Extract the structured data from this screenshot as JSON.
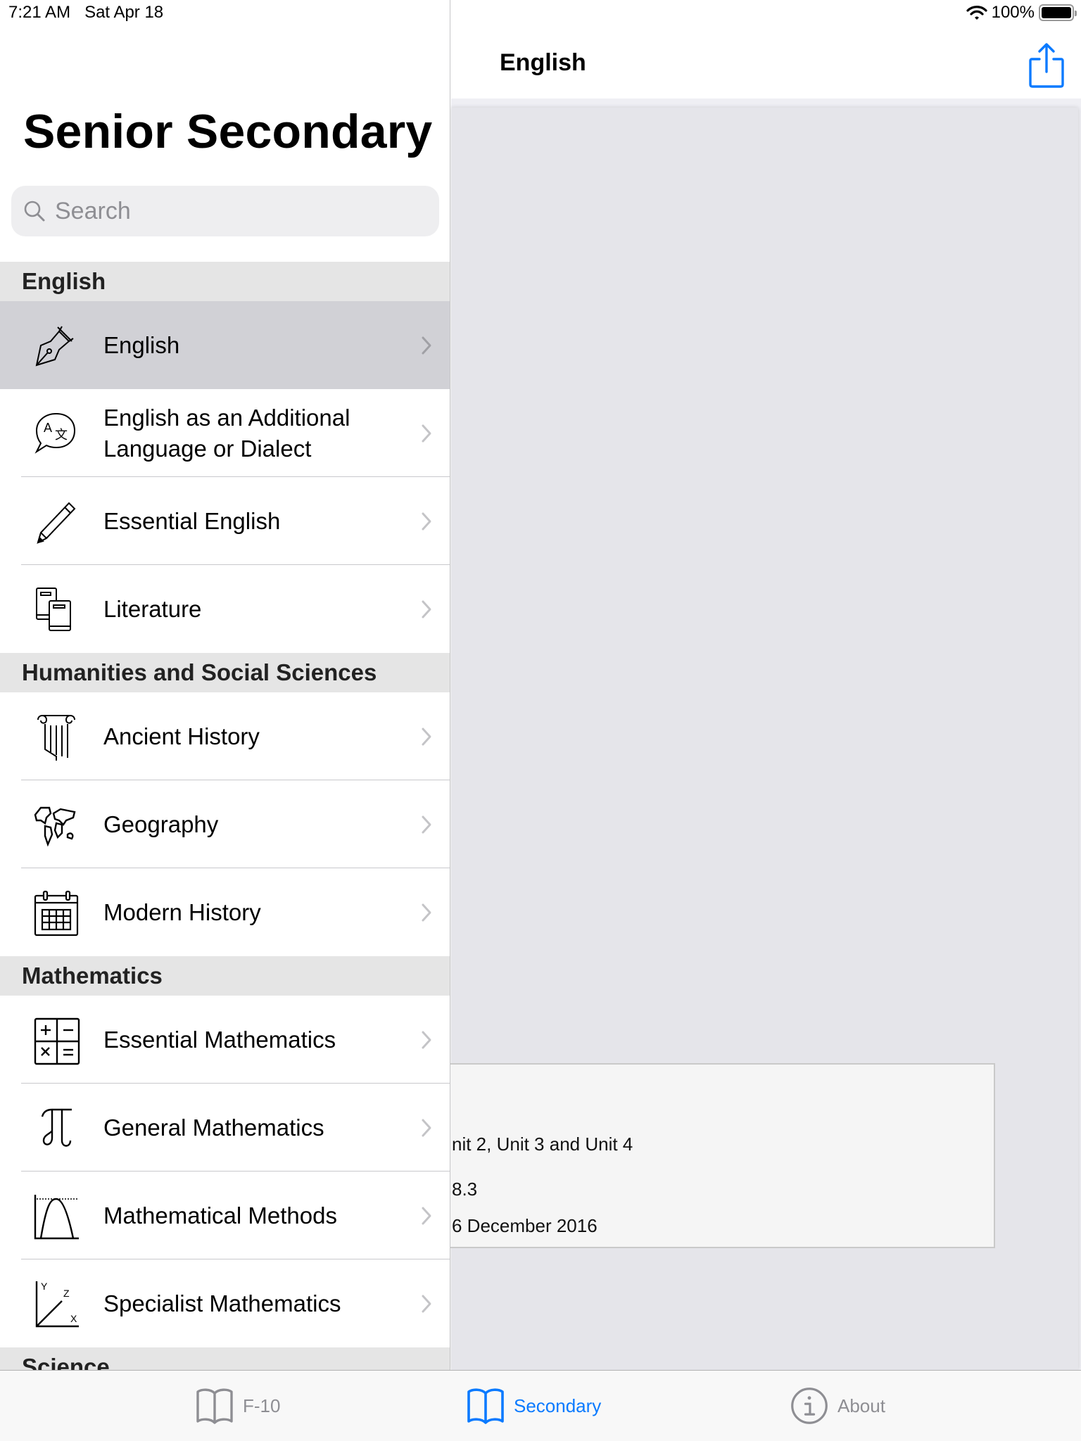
{
  "status_bar": {
    "time": "7:21 AM",
    "date": "Sat Apr 18",
    "battery_percent": "100%",
    "battery_level": 1.0
  },
  "sidebar": {
    "title": "Senior Secondary",
    "search": {
      "placeholder": "Search",
      "value": ""
    },
    "sections": [
      {
        "header": "English",
        "items": [
          {
            "label": "English",
            "icon": "fountain-pen-icon",
            "selected": true
          },
          {
            "label": "English as an Additional Language or Dialect",
            "icon": "translate-bubble-icon",
            "selected": false
          },
          {
            "label": "Essential English",
            "icon": "pencil-icon",
            "selected": false
          },
          {
            "label": "Literature",
            "icon": "books-icon",
            "selected": false
          }
        ]
      },
      {
        "header": "Humanities and Social Sciences",
        "items": [
          {
            "label": "Ancient History",
            "icon": "ionic-column-icon",
            "selected": false
          },
          {
            "label": "Geography",
            "icon": "world-map-icon",
            "selected": false
          },
          {
            "label": "Modern History",
            "icon": "calendar-icon",
            "selected": false
          }
        ]
      },
      {
        "header": "Mathematics",
        "items": [
          {
            "label": "Essential Mathematics",
            "icon": "calculator-operators-icon",
            "selected": false
          },
          {
            "label": "General Mathematics",
            "icon": "pi-icon",
            "selected": false
          },
          {
            "label": "Mathematical Methods",
            "icon": "parabola-graph-icon",
            "selected": false
          },
          {
            "label": "Specialist Mathematics",
            "icon": "xyz-axes-icon",
            "selected": false
          }
        ]
      },
      {
        "header": "Science",
        "items": []
      }
    ]
  },
  "detail": {
    "title": "English",
    "share_label": "Share",
    "info_lines": [
      "nit 2, Unit 3 and Unit 4",
      "8.3",
      "6 December 2016"
    ]
  },
  "tabbar": {
    "tabs": [
      {
        "label": "F-10",
        "icon": "book-icon",
        "active": false
      },
      {
        "label": "Secondary",
        "icon": "book-icon",
        "active": true
      },
      {
        "label": "About",
        "icon": "info-circle-icon",
        "active": false
      }
    ]
  },
  "colors": {
    "accent": "#0a7aff",
    "inactive_tab": "#8e8e93",
    "selected_row": "#d1d1d6",
    "section_header_bg": "#e5e5e5"
  }
}
